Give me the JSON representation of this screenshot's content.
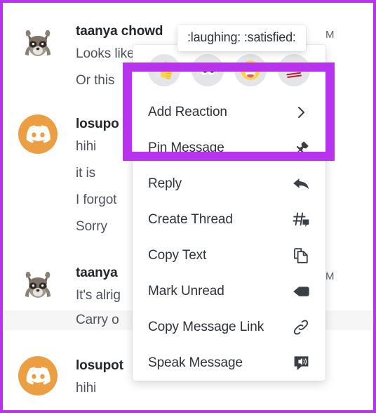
{
  "app": {
    "name": "Discord",
    "accent_purple": "#b833ee",
    "brand_orange": "#eb9e42"
  },
  "chat": {
    "groups": [
      {
        "avatar": "raccoon-avatar",
        "username": "taanya chowd",
        "timestamp_clip": "M",
        "lines": [
          "Looks like you",
          "Or this"
        ]
      },
      {
        "avatar": "discord-logo-avatar",
        "username": "losupo",
        "lines": [
          "hihi",
          "it is",
          "I forgot",
          "Sorry"
        ]
      },
      {
        "avatar": "raccoon-avatar",
        "username": "taanya",
        "timestamp_clip": "M",
        "lines": [
          "It's alrig",
          "Carry o"
        ]
      },
      {
        "avatar": "discord-logo-avatar",
        "username": "losupot",
        "lines": [
          "hihi"
        ]
      }
    ]
  },
  "tooltip": {
    "text": ":laughing: :satisfied:"
  },
  "context_menu": {
    "reactions": [
      {
        "name": "thumbs-up-emoji",
        "label": ":thumbsup:"
      },
      {
        "name": "eyes-emoji",
        "label": ":eyes:"
      },
      {
        "name": "laughing-emoji",
        "label": ":laughing:"
      },
      {
        "name": "hundred-points-emoji",
        "label": ":100:"
      }
    ],
    "items": [
      {
        "label": "Add Reaction",
        "icon": "chevron-right-icon"
      },
      {
        "label": "Pin Message",
        "icon": "pushpin-icon"
      },
      {
        "label": "Reply",
        "icon": "reply-arrow-icon"
      },
      {
        "label": "Create Thread",
        "icon": "thread-hash-icon"
      },
      {
        "label": "Copy Text",
        "icon": "copy-icon"
      },
      {
        "label": "Mark Unread",
        "icon": "mark-unread-icon"
      },
      {
        "label": "Copy Message Link",
        "icon": "link-icon"
      },
      {
        "label": "Speak Message",
        "icon": "speaker-icon"
      }
    ]
  }
}
